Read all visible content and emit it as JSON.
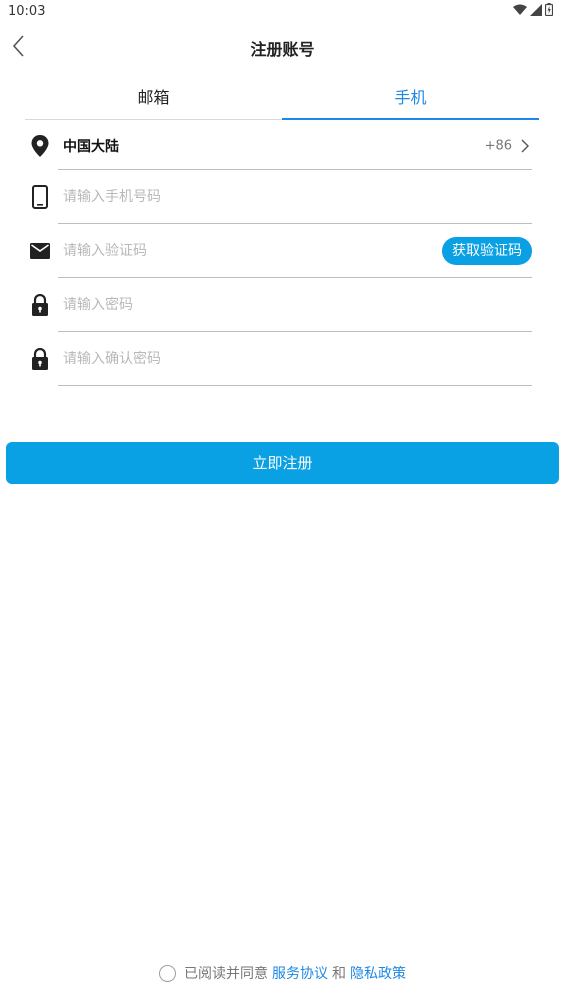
{
  "status_bar": {
    "time": "10:03"
  },
  "header": {
    "title": "注册账号"
  },
  "tabs": [
    {
      "label": "邮箱",
      "active": false
    },
    {
      "label": "手机",
      "active": true
    }
  ],
  "form": {
    "region": {
      "name": "中国大陆",
      "code": "+86"
    },
    "phone": {
      "placeholder": "请输入手机号码",
      "value": ""
    },
    "verification_code": {
      "placeholder": "请输入验证码",
      "value": "",
      "button_label": "获取验证码"
    },
    "password": {
      "placeholder": "请输入密码",
      "value": ""
    },
    "confirm_password": {
      "placeholder": "请输入确认密码",
      "value": ""
    }
  },
  "register_button": {
    "label": "立即注册"
  },
  "agreement": {
    "prefix": "已阅读并同意",
    "service_link": "服务协议",
    "conjunction": "和",
    "privacy_link": "隐私政策",
    "checked": false
  },
  "colors": {
    "accent": "#0aa0e4",
    "tab_active": "#1e88e5",
    "link": "#1e88e5"
  },
  "icons": [
    "back-arrow-icon",
    "location-pin-icon",
    "phone-icon",
    "mail-icon",
    "lock-icon",
    "chevron-right-icon",
    "wifi-icon",
    "signal-icon",
    "battery-icon"
  ]
}
